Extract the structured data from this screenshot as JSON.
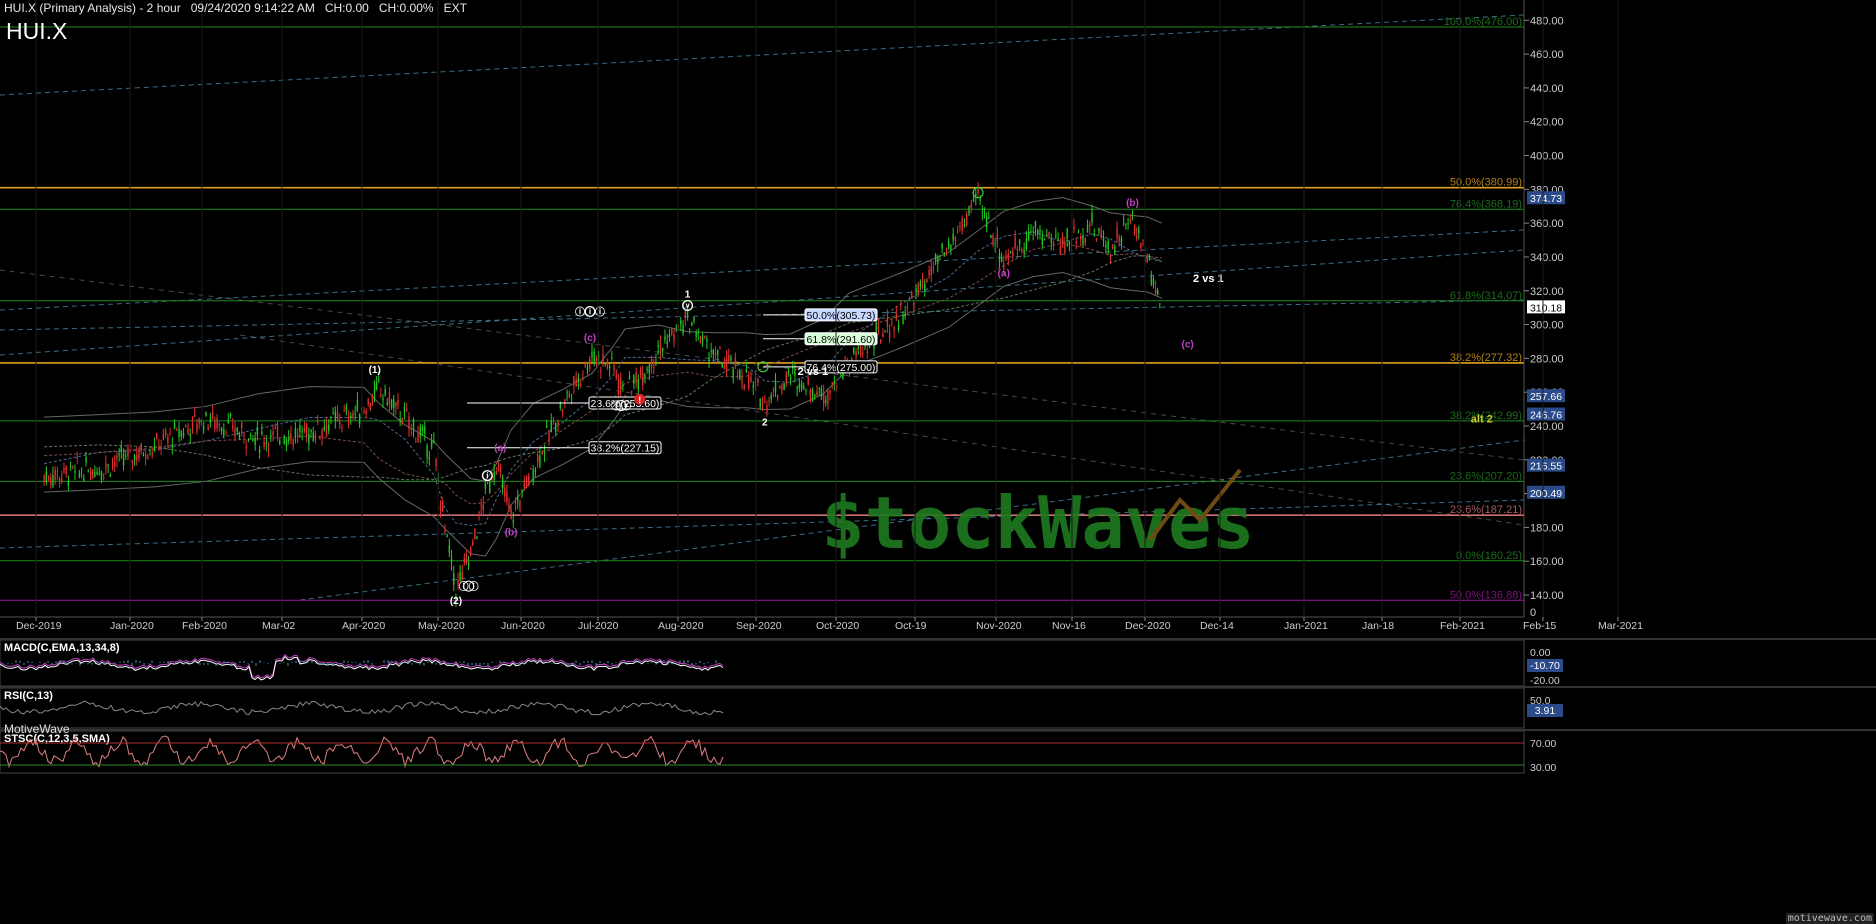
{
  "header": {
    "title": "HUI.X (Primary Analysis) - 2 hour",
    "datetime": "09/24/2020 9:14:22 AM",
    "change": "CH:0.00",
    "change_pct": "CH:0.00%",
    "session": "EXT",
    "symbol": "HUI.X"
  },
  "branding": {
    "platform": "MotiveWave",
    "watermark_text": "$tockWaves",
    "footer": "motivewave.com"
  },
  "colors": {
    "background": "#000000",
    "green_line": "#1f8a1f",
    "orange_line": "#e0a020",
    "magenta_line": "#9a1a9a",
    "salmon_line": "#d07070",
    "dashed_blue": "#4a8aa8",
    "price_label_bg": "#2a4a8a",
    "candle_up": "#22c822",
    "candle_down": "#e03030",
    "annotation_magenta": "#c040c0",
    "annotation_white": "#ffffff",
    "alt_yellow": "#c8c830",
    "watermark_green": "#1e7a1e",
    "watermark_brown": "#6e4a14"
  },
  "chart_data": {
    "type": "candlestick",
    "timeframe": "2 hour",
    "ylim": [
      127,
      492
    ],
    "y_ticks": [
      140,
      160,
      180,
      200,
      220,
      240,
      260,
      280,
      300,
      320,
      340,
      360,
      380,
      400,
      420,
      440,
      460,
      480
    ],
    "x_tick_labels": [
      "Dec-2019",
      "Jan-2020",
      "Feb-2020",
      "Mar-02",
      "Apr-2020",
      "May-2020",
      "Jun-2020",
      "Jul-2020",
      "Aug-2020",
      "Sep-2020",
      "Oct-2020",
      "Oct-19",
      "Nov-2020",
      "Nov-16",
      "Dec-2020",
      "Dec-14",
      "Jan-2021",
      "Jan-18",
      "Feb-2021",
      "Feb-15",
      "Mar-2021"
    ],
    "price_path": [
      [
        "2019-11-25",
        210
      ],
      [
        "2019-12-10",
        215
      ],
      [
        "2019-12-25",
        228
      ],
      [
        "2020-01-08",
        245
      ],
      [
        "2020-01-22",
        232
      ],
      [
        "2020-02-05",
        236
      ],
      [
        "2020-02-20",
        250
      ],
      [
        "2020-02-24",
        262
      ],
      [
        "2020-03-02",
        245
      ],
      [
        "2020-03-10",
        225
      ],
      [
        "2020-03-13",
        180
      ],
      [
        "2020-03-16",
        143
      ],
      [
        "2020-03-20",
        165
      ],
      [
        "2020-03-24",
        200
      ],
      [
        "2020-03-27",
        218
      ],
      [
        "2020-03-31",
        186
      ],
      [
        "2020-04-06",
        215
      ],
      [
        "2020-04-14",
        252
      ],
      [
        "2020-04-22",
        282
      ],
      [
        "2020-04-28",
        275
      ],
      [
        "2020-05-01",
        258
      ],
      [
        "2020-05-10",
        285
      ],
      [
        "2020-05-18",
        303
      ],
      [
        "2020-05-25",
        282
      ],
      [
        "2020-06-03",
        268
      ],
      [
        "2020-06-08",
        255
      ],
      [
        "2020-06-15",
        270
      ],
      [
        "2020-06-24",
        258
      ],
      [
        "2020-07-01",
        278
      ],
      [
        "2020-07-15",
        305
      ],
      [
        "2020-07-28",
        345
      ],
      [
        "2020-08-05",
        375
      ],
      [
        "2020-08-12",
        338
      ],
      [
        "2020-08-20",
        355
      ],
      [
        "2020-08-28",
        348
      ],
      [
        "2020-09-05",
        358
      ],
      [
        "2020-09-10",
        345
      ],
      [
        "2020-09-16",
        362
      ],
      [
        "2020-09-20",
        340
      ],
      [
        "2020-09-24",
        310
      ]
    ],
    "horizontal_levels": [
      {
        "label": "100.0%(476.00)",
        "value": 476.0,
        "color": "green"
      },
      {
        "label": "50.0%(380.99)",
        "value": 380.99,
        "color": "orange"
      },
      {
        "label": "76.4%(368.19)",
        "value": 368.19,
        "color": "green"
      },
      {
        "label": "61.8%(314.07)",
        "value": 314.07,
        "color": "green"
      },
      {
        "label": "38.2%(277.32)",
        "value": 277.32,
        "color": "orange"
      },
      {
        "label": "38.2%(242.99)",
        "value": 242.99,
        "color": "green"
      },
      {
        "label": "23.6%(207.20)",
        "value": 207.2,
        "color": "green"
      },
      {
        "label": "23.6%(187.21)",
        "value": 187.21,
        "color": "salmon"
      },
      {
        "label": "0.0%(160.25)",
        "value": 160.25,
        "color": "green"
      },
      {
        "label": "50.0%(136.88)",
        "value": 136.88,
        "color": "magenta"
      }
    ],
    "target_boxes": [
      {
        "label": "50.0%(305.73)",
        "value": 305.73,
        "group": "2 vs 1 upper"
      },
      {
        "label": "61.8%(291.60)",
        "value": 291.6,
        "group": "2 vs 1 upper"
      },
      {
        "label": "76.4%(275.00)",
        "value": 275.0,
        "group": "2 vs 1 upper"
      },
      {
        "label": "23.6%(253.60)",
        "value": 253.6,
        "group": "2 vs 1 lower"
      },
      {
        "label": "38.2%(227.15)",
        "value": 227.15,
        "group": "2 vs 1 lower"
      }
    ],
    "price_labels": [
      {
        "value": "374.73"
      },
      {
        "value": "310.18",
        "current": true
      },
      {
        "value": "257.66"
      },
      {
        "value": "246.76"
      },
      {
        "value": "216.55"
      },
      {
        "value": "200.49"
      }
    ],
    "wave_labels": [
      {
        "text": "(1)",
        "date": "2020-02-24",
        "price": 262,
        "color": "white"
      },
      {
        "text": "(2)",
        "date": "2020-03-16",
        "price": 143,
        "color": "white"
      },
      {
        "text": "ⓘ",
        "date": "2020-03-24",
        "price": 200,
        "color": "white"
      },
      {
        "text": "ⓘⓘ",
        "date": "2020-03-20",
        "price": 150,
        "color": "white"
      },
      {
        "text": "(a)",
        "date": "2020-03-27",
        "price": 218,
        "color": "magenta"
      },
      {
        "text": "(b)",
        "date": "2020-03-31",
        "price": 186,
        "color": "magenta"
      },
      {
        "text": "(c)",
        "date": "2020-04-22",
        "price": 282,
        "color": "magenta"
      },
      {
        "text": "ⓘⓘⓘ",
        "date": "2020-04-22",
        "price": 290,
        "color": "white"
      },
      {
        "text": "ⓘⓥ",
        "date": "2020-05-01",
        "price": 258,
        "color": "white"
      },
      {
        "text": "1",
        "date": "2020-05-18",
        "price": 303,
        "color": "white"
      },
      {
        "text": "ⓥ",
        "date": "2020-05-18",
        "price": 303,
        "color": "white"
      },
      {
        "text": "2",
        "date": "2020-06-08",
        "price": 252,
        "color": "white"
      },
      {
        "text": "(a)",
        "date": "2020-08-12",
        "price": 338,
        "color": "magenta"
      },
      {
        "text": "(b)",
        "date": "2020-09-16",
        "price": 362,
        "color": "magenta"
      },
      {
        "text": "(c)",
        "date": "2020-10-01",
        "price": 283,
        "color": "magenta"
      },
      {
        "text": "2 vs 1",
        "date": "2020-10-05",
        "price": 318,
        "color": "white"
      },
      {
        "text": "2 vs 1",
        "date": "2020-06-20",
        "price": 262,
        "color": "white"
      },
      {
        "text": "alt 2",
        "date": "2020-12-20",
        "price": 242,
        "color": "yellow"
      }
    ],
    "indicators": [
      {
        "name": "MACD(C,EMA,13,34,8)",
        "ticks": [
          "0.00",
          "-20.00"
        ],
        "current": "-10.70"
      },
      {
        "name": "RSI(C,13)",
        "ticks": [
          "50.0"
        ],
        "current": "3.91"
      },
      {
        "name": "STSC(C,12,3,5,SMA)",
        "ticks": [
          "70.00",
          "30.00"
        ],
        "current": ""
      }
    ],
    "bottom_axis_zero": "0"
  }
}
